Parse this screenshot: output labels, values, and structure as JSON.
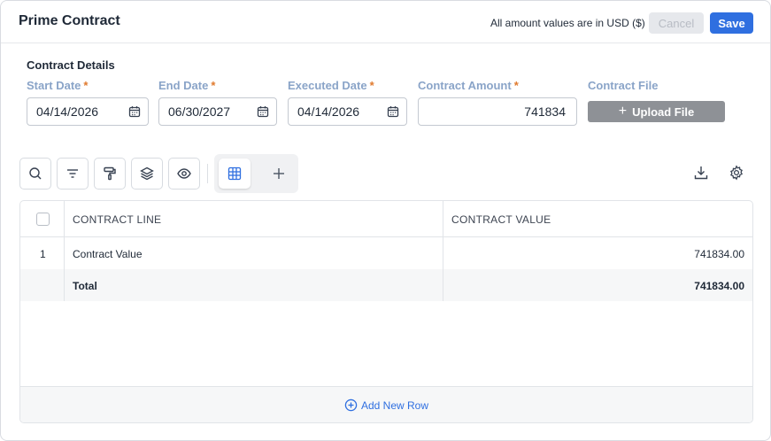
{
  "header": {
    "title": "Prime Contract",
    "currency_note": "All amount values are in USD ($)",
    "cancel_label": "Cancel",
    "save_label": "Save"
  },
  "details": {
    "section_title": "Contract Details",
    "start_date": {
      "label": "Start Date",
      "required": "*",
      "value": "04/14/2026"
    },
    "end_date": {
      "label": "End Date",
      "required": "*",
      "value": "06/30/2027"
    },
    "executed_date": {
      "label": "Executed Date",
      "required": "*",
      "value": "04/14/2026"
    },
    "contract_amount": {
      "label": "Contract Amount",
      "required": "*",
      "value": "741834"
    },
    "contract_file": {
      "label": "Contract File",
      "upload_label": "Upload File",
      "upload_icon": "+"
    }
  },
  "toolbar": {
    "icons": [
      "search-icon",
      "filter-icon",
      "paint-roller-icon",
      "layers-icon",
      "eye-icon",
      "grid-icon",
      "plus-icon",
      "download-icon",
      "gear-icon"
    ],
    "add_glyph": "+"
  },
  "table": {
    "columns": [
      "CONTRACT LINE",
      "CONTRACT VALUE"
    ],
    "rows": [
      {
        "num": "1",
        "name": "Contract Value",
        "value": "741834.00"
      }
    ],
    "total": {
      "label": "Total",
      "value": "741834.00"
    },
    "add_row_label": "Add New Row"
  },
  "colors": {
    "accent": "#2f6fe0",
    "label": "#8aa4c8",
    "required": "#e07a2e",
    "upload_button": "#8e9196"
  }
}
